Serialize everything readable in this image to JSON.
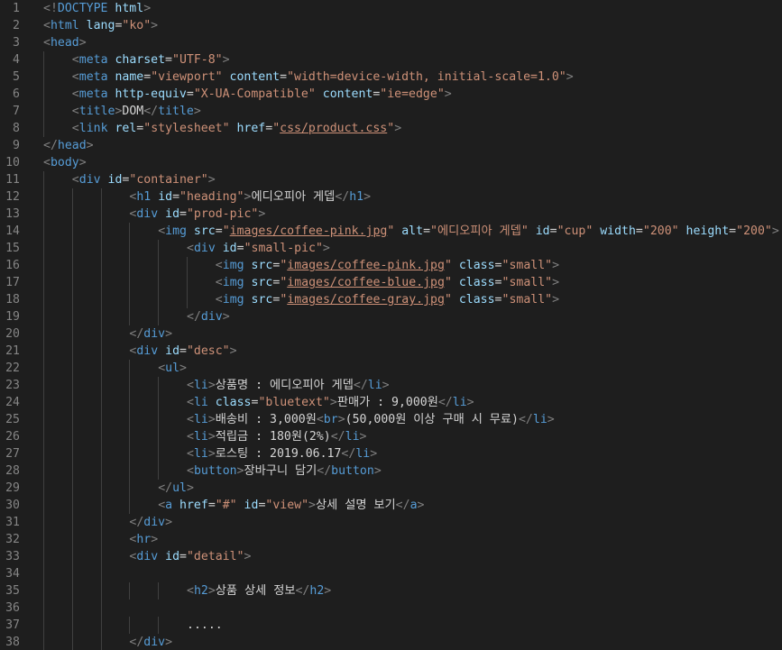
{
  "colors": {
    "background": "#1e1e1e",
    "line_number": "#858585",
    "tag": "#569cd6",
    "attribute": "#9cdcfe",
    "string": "#ce9178",
    "text": "#d4d4d4",
    "punctuation": "#808080",
    "indent_guide": "#404040"
  },
  "lines": [
    {
      "n": "1",
      "indent": 0,
      "tokens": [
        [
          "p",
          "<!"
        ],
        [
          "d",
          "DOCTYPE"
        ],
        [
          "x",
          " "
        ],
        [
          "a",
          "html"
        ],
        [
          "p",
          ">"
        ]
      ]
    },
    {
      "n": "2",
      "indent": 0,
      "tokens": [
        [
          "p",
          "<"
        ],
        [
          "g",
          "html"
        ],
        [
          "x",
          " "
        ],
        [
          "a",
          "lang"
        ],
        [
          "x",
          "="
        ],
        [
          "s",
          "\"ko\""
        ],
        [
          "p",
          ">"
        ]
      ]
    },
    {
      "n": "3",
      "indent": 0,
      "tokens": [
        [
          "p",
          "<"
        ],
        [
          "g",
          "head"
        ],
        [
          "p",
          ">"
        ]
      ]
    },
    {
      "n": "4",
      "indent": 1,
      "tokens": [
        [
          "p",
          "<"
        ],
        [
          "g",
          "meta"
        ],
        [
          "x",
          " "
        ],
        [
          "a",
          "charset"
        ],
        [
          "x",
          "="
        ],
        [
          "s",
          "\"UTF-8\""
        ],
        [
          "p",
          ">"
        ]
      ]
    },
    {
      "n": "5",
      "indent": 1,
      "tokens": [
        [
          "p",
          "<"
        ],
        [
          "g",
          "meta"
        ],
        [
          "x",
          " "
        ],
        [
          "a",
          "name"
        ],
        [
          "x",
          "="
        ],
        [
          "s",
          "\"viewport\""
        ],
        [
          "x",
          " "
        ],
        [
          "a",
          "content"
        ],
        [
          "x",
          "="
        ],
        [
          "s",
          "\"width=device-width, initial-scale=1.0\""
        ],
        [
          "p",
          ">"
        ]
      ]
    },
    {
      "n": "6",
      "indent": 1,
      "tokens": [
        [
          "p",
          "<"
        ],
        [
          "g",
          "meta"
        ],
        [
          "x",
          " "
        ],
        [
          "a",
          "http-equiv"
        ],
        [
          "x",
          "="
        ],
        [
          "s",
          "\"X-UA-Compatible\""
        ],
        [
          "x",
          " "
        ],
        [
          "a",
          "content"
        ],
        [
          "x",
          "="
        ],
        [
          "s",
          "\"ie=edge\""
        ],
        [
          "p",
          ">"
        ]
      ]
    },
    {
      "n": "7",
      "indent": 1,
      "tokens": [
        [
          "p",
          "<"
        ],
        [
          "g",
          "title"
        ],
        [
          "p",
          ">"
        ],
        [
          "x",
          "DOM"
        ],
        [
          "p",
          "</"
        ],
        [
          "g",
          "title"
        ],
        [
          "p",
          ">"
        ]
      ]
    },
    {
      "n": "8",
      "indent": 1,
      "tokens": [
        [
          "p",
          "<"
        ],
        [
          "g",
          "link"
        ],
        [
          "x",
          " "
        ],
        [
          "a",
          "rel"
        ],
        [
          "x",
          "="
        ],
        [
          "s",
          "\"stylesheet\""
        ],
        [
          "x",
          " "
        ],
        [
          "a",
          "href"
        ],
        [
          "x",
          "="
        ],
        [
          "s",
          "\""
        ],
        [
          "l",
          "css/product.css"
        ],
        [
          "s",
          "\""
        ],
        [
          "p",
          ">"
        ]
      ]
    },
    {
      "n": "9",
      "indent": 0,
      "tokens": [
        [
          "p",
          "</"
        ],
        [
          "g",
          "head"
        ],
        [
          "p",
          ">"
        ]
      ]
    },
    {
      "n": "10",
      "indent": 0,
      "tokens": [
        [
          "p",
          "<"
        ],
        [
          "g",
          "body"
        ],
        [
          "p",
          ">"
        ]
      ]
    },
    {
      "n": "11",
      "indent": 1,
      "tokens": [
        [
          "p",
          "<"
        ],
        [
          "g",
          "div"
        ],
        [
          "x",
          " "
        ],
        [
          "a",
          "id"
        ],
        [
          "x",
          "="
        ],
        [
          "s",
          "\"container\""
        ],
        [
          "p",
          ">"
        ]
      ]
    },
    {
      "n": "12",
      "indent": 3,
      "tokens": [
        [
          "p",
          "<"
        ],
        [
          "g",
          "h1"
        ],
        [
          "x",
          " "
        ],
        [
          "a",
          "id"
        ],
        [
          "x",
          "="
        ],
        [
          "s",
          "\"heading\""
        ],
        [
          "p",
          ">"
        ],
        [
          "x",
          "에디오피아 게뎁"
        ],
        [
          "p",
          "</"
        ],
        [
          "g",
          "h1"
        ],
        [
          "p",
          ">"
        ]
      ]
    },
    {
      "n": "13",
      "indent": 3,
      "tokens": [
        [
          "p",
          "<"
        ],
        [
          "g",
          "div"
        ],
        [
          "x",
          " "
        ],
        [
          "a",
          "id"
        ],
        [
          "x",
          "="
        ],
        [
          "s",
          "\"prod-pic\""
        ],
        [
          "p",
          ">"
        ]
      ]
    },
    {
      "n": "14",
      "indent": 4,
      "tokens": [
        [
          "p",
          "<"
        ],
        [
          "g",
          "img"
        ],
        [
          "x",
          " "
        ],
        [
          "a",
          "src"
        ],
        [
          "x",
          "="
        ],
        [
          "s",
          "\""
        ],
        [
          "l",
          "images/coffee-pink.jpg"
        ],
        [
          "s",
          "\""
        ],
        [
          "x",
          " "
        ],
        [
          "a",
          "alt"
        ],
        [
          "x",
          "="
        ],
        [
          "s",
          "\"에디오피아 게뎁\""
        ],
        [
          "x",
          " "
        ],
        [
          "a",
          "id"
        ],
        [
          "x",
          "="
        ],
        [
          "s",
          "\"cup\""
        ],
        [
          "x",
          " "
        ],
        [
          "a",
          "width"
        ],
        [
          "x",
          "="
        ],
        [
          "s",
          "\"200\""
        ],
        [
          "x",
          " "
        ],
        [
          "a",
          "height"
        ],
        [
          "x",
          "="
        ],
        [
          "s",
          "\"200\""
        ],
        [
          "p",
          ">"
        ]
      ]
    },
    {
      "n": "15",
      "indent": 5,
      "tokens": [
        [
          "p",
          "<"
        ],
        [
          "g",
          "div"
        ],
        [
          "x",
          " "
        ],
        [
          "a",
          "id"
        ],
        [
          "x",
          "="
        ],
        [
          "s",
          "\"small-pic\""
        ],
        [
          "p",
          ">"
        ]
      ]
    },
    {
      "n": "16",
      "indent": 6,
      "tokens": [
        [
          "p",
          "<"
        ],
        [
          "g",
          "img"
        ],
        [
          "x",
          " "
        ],
        [
          "a",
          "src"
        ],
        [
          "x",
          "="
        ],
        [
          "s",
          "\""
        ],
        [
          "l",
          "images/coffee-pink.jpg"
        ],
        [
          "s",
          "\""
        ],
        [
          "x",
          " "
        ],
        [
          "a",
          "class"
        ],
        [
          "x",
          "="
        ],
        [
          "s",
          "\"small\""
        ],
        [
          "p",
          ">"
        ]
      ]
    },
    {
      "n": "17",
      "indent": 6,
      "tokens": [
        [
          "p",
          "<"
        ],
        [
          "g",
          "img"
        ],
        [
          "x",
          " "
        ],
        [
          "a",
          "src"
        ],
        [
          "x",
          "="
        ],
        [
          "s",
          "\""
        ],
        [
          "l",
          "images/coffee-blue.jpg"
        ],
        [
          "s",
          "\""
        ],
        [
          "x",
          " "
        ],
        [
          "a",
          "class"
        ],
        [
          "x",
          "="
        ],
        [
          "s",
          "\"small\""
        ],
        [
          "p",
          ">"
        ]
      ]
    },
    {
      "n": "18",
      "indent": 6,
      "tokens": [
        [
          "p",
          "<"
        ],
        [
          "g",
          "img"
        ],
        [
          "x",
          " "
        ],
        [
          "a",
          "src"
        ],
        [
          "x",
          "="
        ],
        [
          "s",
          "\""
        ],
        [
          "l",
          "images/coffee-gray.jpg"
        ],
        [
          "s",
          "\""
        ],
        [
          "x",
          " "
        ],
        [
          "a",
          "class"
        ],
        [
          "x",
          "="
        ],
        [
          "s",
          "\"small\""
        ],
        [
          "p",
          ">"
        ]
      ]
    },
    {
      "n": "19",
      "indent": 5,
      "tokens": [
        [
          "p",
          "</"
        ],
        [
          "g",
          "div"
        ],
        [
          "p",
          ">"
        ]
      ]
    },
    {
      "n": "20",
      "indent": 3,
      "tokens": [
        [
          "p",
          "</"
        ],
        [
          "g",
          "div"
        ],
        [
          "p",
          ">"
        ]
      ]
    },
    {
      "n": "21",
      "indent": 3,
      "tokens": [
        [
          "p",
          "<"
        ],
        [
          "g",
          "div"
        ],
        [
          "x",
          " "
        ],
        [
          "a",
          "id"
        ],
        [
          "x",
          "="
        ],
        [
          "s",
          "\"desc\""
        ],
        [
          "p",
          ">"
        ]
      ]
    },
    {
      "n": "22",
      "indent": 4,
      "tokens": [
        [
          "p",
          "<"
        ],
        [
          "g",
          "ul"
        ],
        [
          "p",
          ">"
        ]
      ]
    },
    {
      "n": "23",
      "indent": 5,
      "tokens": [
        [
          "p",
          "<"
        ],
        [
          "g",
          "li"
        ],
        [
          "p",
          ">"
        ],
        [
          "x",
          "상품명 : 에디오피아 게뎁"
        ],
        [
          "p",
          "</"
        ],
        [
          "g",
          "li"
        ],
        [
          "p",
          ">"
        ]
      ]
    },
    {
      "n": "24",
      "indent": 5,
      "tokens": [
        [
          "p",
          "<"
        ],
        [
          "g",
          "li"
        ],
        [
          "x",
          " "
        ],
        [
          "a",
          "class"
        ],
        [
          "x",
          "="
        ],
        [
          "s",
          "\"bluetext\""
        ],
        [
          "p",
          ">"
        ],
        [
          "x",
          "판매가 : 9,000원"
        ],
        [
          "p",
          "</"
        ],
        [
          "g",
          "li"
        ],
        [
          "p",
          ">"
        ]
      ]
    },
    {
      "n": "25",
      "indent": 5,
      "tokens": [
        [
          "p",
          "<"
        ],
        [
          "g",
          "li"
        ],
        [
          "p",
          ">"
        ],
        [
          "x",
          "배송비 : 3,000원"
        ],
        [
          "p",
          "<"
        ],
        [
          "g",
          "br"
        ],
        [
          "p",
          ">"
        ],
        [
          "x",
          "(50,000원 이상 구매 시 무료)"
        ],
        [
          "p",
          "</"
        ],
        [
          "g",
          "li"
        ],
        [
          "p",
          ">"
        ]
      ]
    },
    {
      "n": "26",
      "indent": 5,
      "tokens": [
        [
          "p",
          "<"
        ],
        [
          "g",
          "li"
        ],
        [
          "p",
          ">"
        ],
        [
          "x",
          "적립금 : 180원(2%)"
        ],
        [
          "p",
          "</"
        ],
        [
          "g",
          "li"
        ],
        [
          "p",
          ">"
        ]
      ]
    },
    {
      "n": "27",
      "indent": 5,
      "tokens": [
        [
          "p",
          "<"
        ],
        [
          "g",
          "li"
        ],
        [
          "p",
          ">"
        ],
        [
          "x",
          "로스팅 : 2019.06.17"
        ],
        [
          "p",
          "</"
        ],
        [
          "g",
          "li"
        ],
        [
          "p",
          ">"
        ]
      ]
    },
    {
      "n": "28",
      "indent": 5,
      "tokens": [
        [
          "p",
          "<"
        ],
        [
          "g",
          "button"
        ],
        [
          "p",
          ">"
        ],
        [
          "x",
          "장바구니 담기"
        ],
        [
          "p",
          "</"
        ],
        [
          "g",
          "button"
        ],
        [
          "p",
          ">"
        ]
      ]
    },
    {
      "n": "29",
      "indent": 4,
      "tokens": [
        [
          "p",
          "</"
        ],
        [
          "g",
          "ul"
        ],
        [
          "p",
          ">"
        ]
      ]
    },
    {
      "n": "30",
      "indent": 4,
      "tokens": [
        [
          "p",
          "<"
        ],
        [
          "g",
          "a"
        ],
        [
          "x",
          " "
        ],
        [
          "a",
          "href"
        ],
        [
          "x",
          "="
        ],
        [
          "s",
          "\"#\""
        ],
        [
          "x",
          " "
        ],
        [
          "a",
          "id"
        ],
        [
          "x",
          "="
        ],
        [
          "s",
          "\"view\""
        ],
        [
          "p",
          ">"
        ],
        [
          "x",
          "상세 설명 보기"
        ],
        [
          "p",
          "</"
        ],
        [
          "g",
          "a"
        ],
        [
          "p",
          ">"
        ]
      ]
    },
    {
      "n": "31",
      "indent": 3,
      "tokens": [
        [
          "p",
          "</"
        ],
        [
          "g",
          "div"
        ],
        [
          "p",
          ">"
        ]
      ]
    },
    {
      "n": "32",
      "indent": 3,
      "tokens": [
        [
          "p",
          "<"
        ],
        [
          "g",
          "hr"
        ],
        [
          "p",
          ">"
        ]
      ]
    },
    {
      "n": "33",
      "indent": 3,
      "tokens": [
        [
          "p",
          "<"
        ],
        [
          "g",
          "div"
        ],
        [
          "x",
          " "
        ],
        [
          "a",
          "id"
        ],
        [
          "x",
          "="
        ],
        [
          "s",
          "\"detail\""
        ],
        [
          "p",
          ">"
        ]
      ]
    },
    {
      "n": "34",
      "indent": 3,
      "tokens": []
    },
    {
      "n": "35",
      "indent": 5,
      "tokens": [
        [
          "p",
          "<"
        ],
        [
          "g",
          "h2"
        ],
        [
          "p",
          ">"
        ],
        [
          "x",
          "상품 상세 정보"
        ],
        [
          "p",
          "</"
        ],
        [
          "g",
          "h2"
        ],
        [
          "p",
          ">"
        ]
      ]
    },
    {
      "n": "36",
      "indent": 3,
      "tokens": []
    },
    {
      "n": "37",
      "indent": 5,
      "tokens": [
        [
          "x",
          "....."
        ]
      ]
    },
    {
      "n": "38",
      "indent": 3,
      "tokens": [
        [
          "p",
          "</"
        ],
        [
          "g",
          "div"
        ],
        [
          "p",
          ">"
        ]
      ]
    }
  ]
}
